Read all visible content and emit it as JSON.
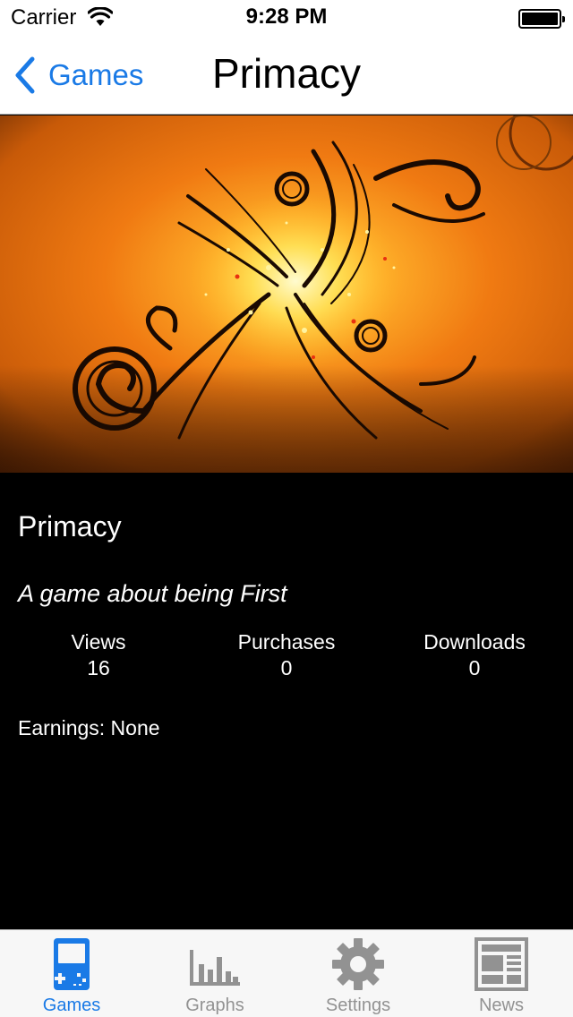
{
  "status_bar": {
    "carrier": "Carrier",
    "time": "9:28 PM"
  },
  "nav_bar": {
    "back_label": "Games",
    "title": "Primacy"
  },
  "game": {
    "name": "Primacy",
    "tagline": "A game about being First",
    "stats": [
      {
        "label": "Views",
        "value": "16"
      },
      {
        "label": "Purchases",
        "value": "0"
      },
      {
        "label": "Downloads",
        "value": "0"
      }
    ],
    "earnings": "Earnings: None"
  },
  "tab_bar": {
    "tabs": [
      {
        "label": "Games",
        "icon": "gameboy-icon",
        "active": true
      },
      {
        "label": "Graphs",
        "icon": "bar-chart-icon",
        "active": false
      },
      {
        "label": "Settings",
        "icon": "gear-icon",
        "active": false
      },
      {
        "label": "News",
        "icon": "newspaper-icon",
        "active": false
      }
    ]
  },
  "colors": {
    "accent": "#1a7ae6",
    "inactive_tab": "#929292",
    "hero_orange": "#e8640a"
  }
}
